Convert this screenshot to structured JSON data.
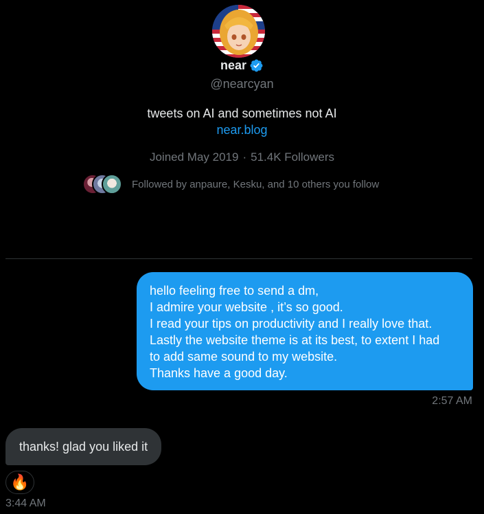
{
  "profile": {
    "display_name": "near",
    "handle": "@nearcyan",
    "bio": "tweets on AI and sometimes not AI",
    "link": "near.blog",
    "joined": "Joined May 2019",
    "followers": "51.4K Followers",
    "followed_by": "Followed by anpaure, Kesku, and 10 others you follow",
    "verified_icon": "verified-badge-icon"
  },
  "messages": {
    "sent": {
      "lines": [
        "hello feeling free to send a dm,",
        "I admire your website , it’s so good.",
        "I read your tips on productivity and I really love that.",
        "Lastly the website theme is at its best, to extent I had",
        "to add same sound to my website.",
        "Thanks have a good day."
      ],
      "time": "2:57 AM"
    },
    "received": {
      "text": "thanks! glad you liked it",
      "reaction": "🔥",
      "time": "3:44 AM"
    }
  },
  "colors": {
    "accent": "#1d9bf0",
    "background": "#000000",
    "received_bubble": "#2f3336",
    "muted_text": "#71767b"
  }
}
